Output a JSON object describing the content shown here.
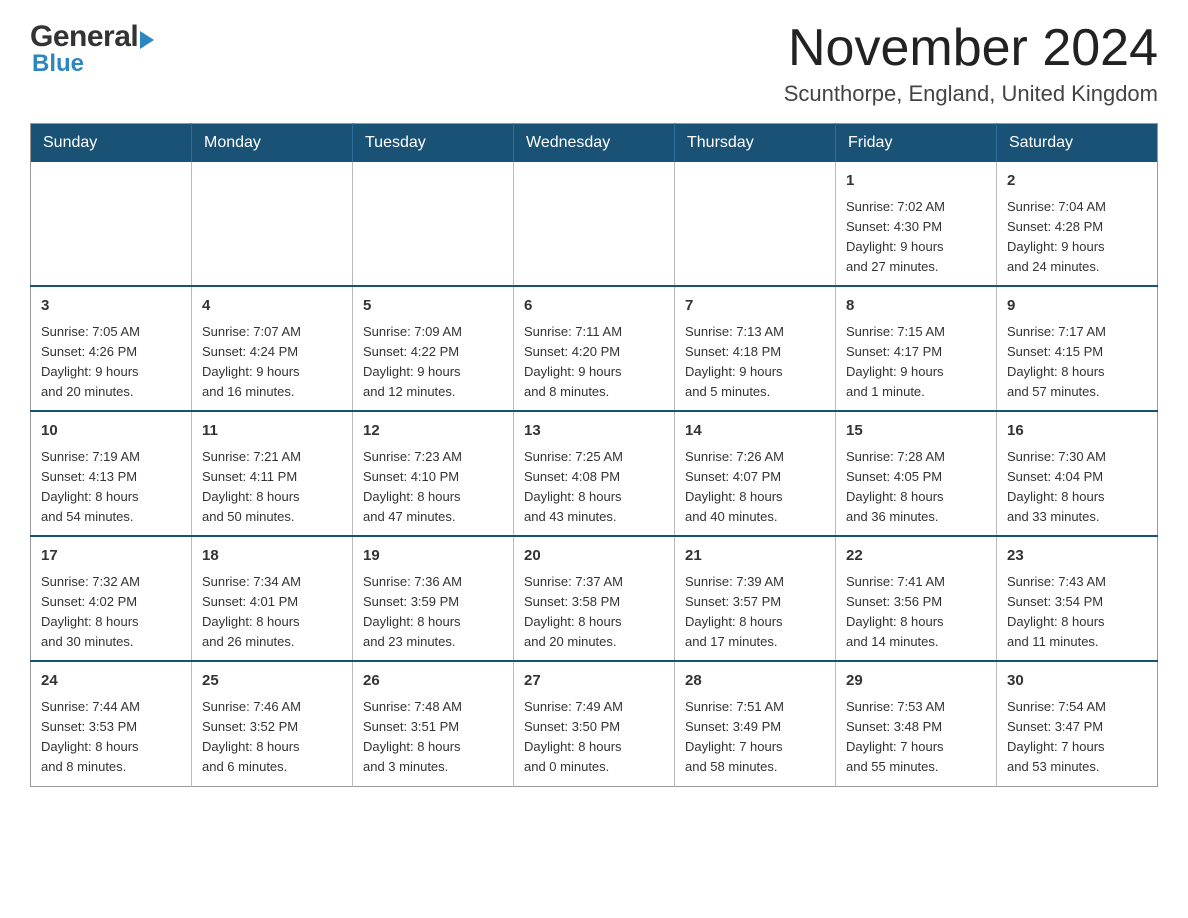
{
  "header": {
    "logo_general": "General",
    "logo_blue": "Blue",
    "month": "November 2024",
    "location": "Scunthorpe, England, United Kingdom"
  },
  "weekdays": [
    "Sunday",
    "Monday",
    "Tuesday",
    "Wednesday",
    "Thursday",
    "Friday",
    "Saturday"
  ],
  "weeks": [
    [
      {
        "day": "",
        "info": ""
      },
      {
        "day": "",
        "info": ""
      },
      {
        "day": "",
        "info": ""
      },
      {
        "day": "",
        "info": ""
      },
      {
        "day": "",
        "info": ""
      },
      {
        "day": "1",
        "info": "Sunrise: 7:02 AM\nSunset: 4:30 PM\nDaylight: 9 hours\nand 27 minutes."
      },
      {
        "day": "2",
        "info": "Sunrise: 7:04 AM\nSunset: 4:28 PM\nDaylight: 9 hours\nand 24 minutes."
      }
    ],
    [
      {
        "day": "3",
        "info": "Sunrise: 7:05 AM\nSunset: 4:26 PM\nDaylight: 9 hours\nand 20 minutes."
      },
      {
        "day": "4",
        "info": "Sunrise: 7:07 AM\nSunset: 4:24 PM\nDaylight: 9 hours\nand 16 minutes."
      },
      {
        "day": "5",
        "info": "Sunrise: 7:09 AM\nSunset: 4:22 PM\nDaylight: 9 hours\nand 12 minutes."
      },
      {
        "day": "6",
        "info": "Sunrise: 7:11 AM\nSunset: 4:20 PM\nDaylight: 9 hours\nand 8 minutes."
      },
      {
        "day": "7",
        "info": "Sunrise: 7:13 AM\nSunset: 4:18 PM\nDaylight: 9 hours\nand 5 minutes."
      },
      {
        "day": "8",
        "info": "Sunrise: 7:15 AM\nSunset: 4:17 PM\nDaylight: 9 hours\nand 1 minute."
      },
      {
        "day": "9",
        "info": "Sunrise: 7:17 AM\nSunset: 4:15 PM\nDaylight: 8 hours\nand 57 minutes."
      }
    ],
    [
      {
        "day": "10",
        "info": "Sunrise: 7:19 AM\nSunset: 4:13 PM\nDaylight: 8 hours\nand 54 minutes."
      },
      {
        "day": "11",
        "info": "Sunrise: 7:21 AM\nSunset: 4:11 PM\nDaylight: 8 hours\nand 50 minutes."
      },
      {
        "day": "12",
        "info": "Sunrise: 7:23 AM\nSunset: 4:10 PM\nDaylight: 8 hours\nand 47 minutes."
      },
      {
        "day": "13",
        "info": "Sunrise: 7:25 AM\nSunset: 4:08 PM\nDaylight: 8 hours\nand 43 minutes."
      },
      {
        "day": "14",
        "info": "Sunrise: 7:26 AM\nSunset: 4:07 PM\nDaylight: 8 hours\nand 40 minutes."
      },
      {
        "day": "15",
        "info": "Sunrise: 7:28 AM\nSunset: 4:05 PM\nDaylight: 8 hours\nand 36 minutes."
      },
      {
        "day": "16",
        "info": "Sunrise: 7:30 AM\nSunset: 4:04 PM\nDaylight: 8 hours\nand 33 minutes."
      }
    ],
    [
      {
        "day": "17",
        "info": "Sunrise: 7:32 AM\nSunset: 4:02 PM\nDaylight: 8 hours\nand 30 minutes."
      },
      {
        "day": "18",
        "info": "Sunrise: 7:34 AM\nSunset: 4:01 PM\nDaylight: 8 hours\nand 26 minutes."
      },
      {
        "day": "19",
        "info": "Sunrise: 7:36 AM\nSunset: 3:59 PM\nDaylight: 8 hours\nand 23 minutes."
      },
      {
        "day": "20",
        "info": "Sunrise: 7:37 AM\nSunset: 3:58 PM\nDaylight: 8 hours\nand 20 minutes."
      },
      {
        "day": "21",
        "info": "Sunrise: 7:39 AM\nSunset: 3:57 PM\nDaylight: 8 hours\nand 17 minutes."
      },
      {
        "day": "22",
        "info": "Sunrise: 7:41 AM\nSunset: 3:56 PM\nDaylight: 8 hours\nand 14 minutes."
      },
      {
        "day": "23",
        "info": "Sunrise: 7:43 AM\nSunset: 3:54 PM\nDaylight: 8 hours\nand 11 minutes."
      }
    ],
    [
      {
        "day": "24",
        "info": "Sunrise: 7:44 AM\nSunset: 3:53 PM\nDaylight: 8 hours\nand 8 minutes."
      },
      {
        "day": "25",
        "info": "Sunrise: 7:46 AM\nSunset: 3:52 PM\nDaylight: 8 hours\nand 6 minutes."
      },
      {
        "day": "26",
        "info": "Sunrise: 7:48 AM\nSunset: 3:51 PM\nDaylight: 8 hours\nand 3 minutes."
      },
      {
        "day": "27",
        "info": "Sunrise: 7:49 AM\nSunset: 3:50 PM\nDaylight: 8 hours\nand 0 minutes."
      },
      {
        "day": "28",
        "info": "Sunrise: 7:51 AM\nSunset: 3:49 PM\nDaylight: 7 hours\nand 58 minutes."
      },
      {
        "day": "29",
        "info": "Sunrise: 7:53 AM\nSunset: 3:48 PM\nDaylight: 7 hours\nand 55 minutes."
      },
      {
        "day": "30",
        "info": "Sunrise: 7:54 AM\nSunset: 3:47 PM\nDaylight: 7 hours\nand 53 minutes."
      }
    ]
  ]
}
